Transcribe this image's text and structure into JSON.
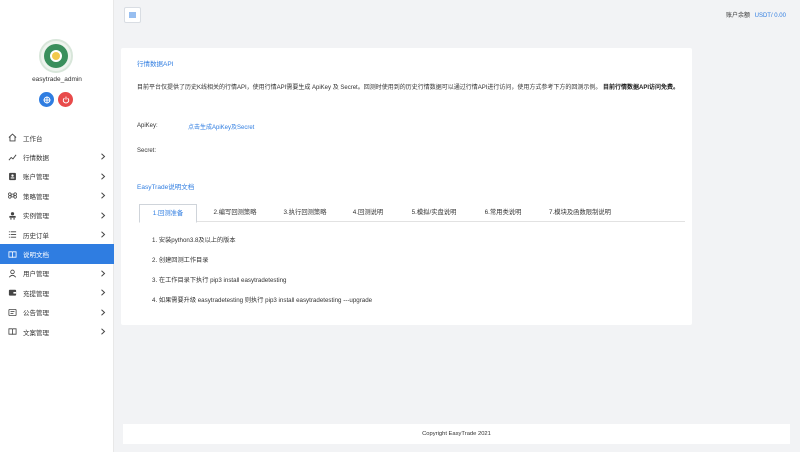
{
  "sidebar": {
    "username": "easytrade_admin",
    "items": [
      {
        "label": "工作台",
        "icon": "home-icon",
        "has_arrow": false
      },
      {
        "label": "行情数据",
        "icon": "chart-line-icon",
        "has_arrow": true
      },
      {
        "label": "账户管理",
        "icon": "account-card-icon",
        "has_arrow": true
      },
      {
        "label": "策略管理",
        "icon": "command-icon",
        "has_arrow": true
      },
      {
        "label": "实例管理",
        "icon": "instance-icon",
        "has_arrow": true
      },
      {
        "label": "历史订单",
        "icon": "list-icon",
        "has_arrow": true
      },
      {
        "label": "说明文档",
        "icon": "book-icon",
        "has_arrow": false,
        "active": true
      },
      {
        "label": "用户管理",
        "icon": "user-icon",
        "has_arrow": true
      },
      {
        "label": "充提管理",
        "icon": "wallet-icon",
        "has_arrow": true
      },
      {
        "label": "公告管理",
        "icon": "notice-icon",
        "has_arrow": true
      },
      {
        "label": "文案管理",
        "icon": "book-icon",
        "has_arrow": true
      }
    ]
  },
  "header": {
    "balance_label": "账户余额",
    "balance_value": "USDT/ 0.00"
  },
  "main": {
    "section_title": "行情数据API",
    "description_plain": "目前平台仅提供了历史K线相关的行情API，使用行情API需要生成 ApiKey 及 Secret。回测时使用到的历史行情数据可以通过行情API进行访问，使用方式参考下方的回测示例。",
    "description_bold": "目前行情数据API访问免费。",
    "apikey_label": "ApiKey:",
    "apikey_link": "点击生成ApiKey及Secret",
    "secret_label": "Secret:",
    "doc_title": "EasyTrade说明文档",
    "tabs": [
      "1.回测准备",
      "2.编写回测策略",
      "3.执行回测策略",
      "4.回测说明",
      "5.模拟/实盘说明",
      "6.常用类说明",
      "7.模块及函数限制说明"
    ],
    "steps": [
      "1. 安装python3.8及以上的版本",
      "2. 创建回测工作目录",
      "3. 在工作目录下执行 pip3 install easytradetesting",
      "4. 如果需要升级 easytradetesting 则执行 pip3 install easytradetesting ---upgrade"
    ]
  },
  "footer": {
    "copyright": "Copyright EasyTrade 2021"
  },
  "colors": {
    "accent": "#2f7de1",
    "danger": "#e84a4a"
  }
}
